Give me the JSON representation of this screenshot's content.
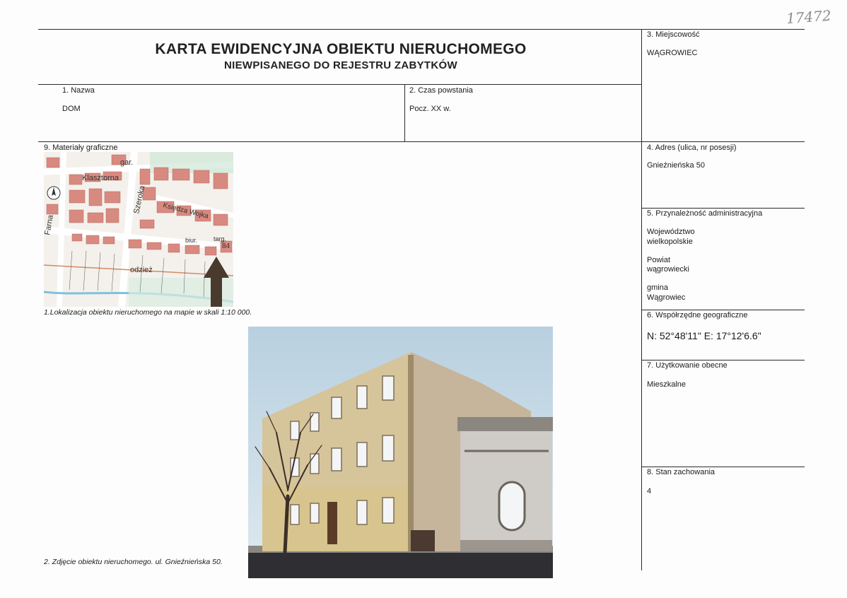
{
  "header": {
    "title": "KARTA EWIDENCYJNA OBIEKTU NIERUCHOMEGO",
    "subtitle": "NIEWPISANEGO DO REJESTRU ZABYTKÓW",
    "archive_number": "17472"
  },
  "fields": {
    "name": {
      "label": "1.    Nazwa",
      "value": "DOM"
    },
    "created": {
      "label": "2. Czas powstania",
      "value": "Pocz. XX w."
    },
    "locality": {
      "label": "3. Miejscowość",
      "value": "WĄGROWIEC"
    },
    "address": {
      "label": "4. Adres (ulica, nr posesji)",
      "value": "Gnieźnieńska 50"
    },
    "admin": {
      "label": "5. Przynależność administracyjna",
      "voivodeship_label": "Województwo",
      "voivodeship": "wielkopolskie",
      "county_label": "Powiat",
      "county": "wągrowiecki",
      "commune_label": "gmina",
      "commune": "Wągrowiec"
    },
    "geo": {
      "label": "6. Współrzędne geograficzne",
      "value": "N: 52°48'11\"  E: 17°12'6.6\""
    },
    "use": {
      "label": "7. Użytkowanie obecne",
      "value": "Mieszkalne"
    },
    "condition": {
      "label": "8. Stan zachowania",
      "value": "4"
    },
    "graphics": {
      "label": "9. Materiały graficzne"
    }
  },
  "map": {
    "labels": {
      "garage": "gar.",
      "street_klasztorna": "Klasztorna",
      "street_farna": "Farna",
      "street_szeroka": "Szeroka",
      "street_wojka": "Księdza Wojka",
      "market": "targ.",
      "office": "biur.",
      "number": "84",
      "clothing": "odzież"
    },
    "caption": "1.Lokalizacja obiektu nieruchomego na mapie w skali 1:10 000."
  },
  "photo": {
    "caption": "2. Zdjęcie obiektu nieruchomego. ul. Gnieźnieńska 50."
  },
  "colors": {
    "building": "#d98a80",
    "map_bg": "#f4f1ec",
    "sky": "#b8d0e0",
    "facade": "#d6c49b"
  }
}
